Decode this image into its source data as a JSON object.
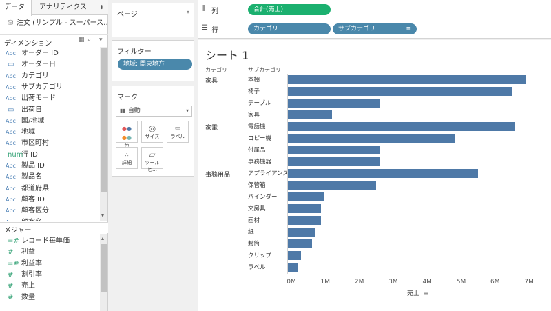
{
  "left_pane": {
    "tab_data": "データ",
    "tab_analytics": "アナリティクス",
    "analytics_caret": "⬍",
    "source": "注文 (サンプル - スーパース…",
    "dimensions_label": "ディメンション",
    "dimensions": [
      {
        "type": "Abc",
        "name": "オーダー ID"
      },
      {
        "type": "cal",
        "name": "オーダー日"
      },
      {
        "type": "Abc",
        "name": "カテゴリ"
      },
      {
        "type": "Abc",
        "name": "サブカテゴリ"
      },
      {
        "type": "Abc",
        "name": "出荷モード"
      },
      {
        "type": "cal",
        "name": "出荷日"
      },
      {
        "type": "Abc",
        "name": "国/地域"
      },
      {
        "type": "Abc",
        "name": "地域"
      },
      {
        "type": "Abc",
        "name": "市区町村"
      },
      {
        "type": "num",
        "name": "行 ID"
      },
      {
        "type": "Abc",
        "name": "製品 ID"
      },
      {
        "type": "Abc",
        "name": "製品名"
      },
      {
        "type": "Abc",
        "name": "都道府県"
      },
      {
        "type": "Abc",
        "name": "顧客 ID"
      },
      {
        "type": "Abc",
        "name": "顧客区分"
      },
      {
        "type": "Abc",
        "name": "顧客名"
      }
    ],
    "measures_label": "メジャー",
    "measures": [
      {
        "type": "=#",
        "name": "レコード毎単価"
      },
      {
        "type": "#",
        "name": "利益"
      },
      {
        "type": "=#",
        "name": "利益率"
      },
      {
        "type": "#",
        "name": "割引率"
      },
      {
        "type": "#",
        "name": "売上"
      },
      {
        "type": "#",
        "name": "数量"
      }
    ]
  },
  "cards": {
    "pages_label": "ページ",
    "filters_label": "フィルター",
    "filter_pill": "地域: 関東地方",
    "marks_label": "マーク",
    "mark_type": "自動",
    "mark_buttons": [
      "色",
      "サイズ",
      "ラベル",
      "詳細",
      "ツールヒ…"
    ]
  },
  "shelves": {
    "columns_label": "列",
    "columns_pill": "合計(売上)",
    "rows_label": "行",
    "rows_pills": [
      "カテゴリ",
      "サブカテゴリ"
    ]
  },
  "view": {
    "sheet_title": "シート 1",
    "col_header_category": "カテゴリ",
    "col_header_subcategory": "サブカテゴリ",
    "axis_title": "売上",
    "bar_color": "#4e79a7"
  },
  "chart_data": {
    "type": "bar",
    "orientation": "horizontal",
    "xlabel": "売上",
    "xlim": [
      0,
      7300000
    ],
    "ticks": [
      "0M",
      "1M",
      "2M",
      "3M",
      "4M",
      "5M",
      "6M",
      "7M"
    ],
    "groups": [
      {
        "category": "家具",
        "items": [
          {
            "name": "本棚",
            "value": 7000000
          },
          {
            "name": "椅子",
            "value": 6600000
          },
          {
            "name": "テーブル",
            "value": 2700000
          },
          {
            "name": "家具",
            "value": 1300000
          }
        ]
      },
      {
        "category": "家電",
        "items": [
          {
            "name": "電話機",
            "value": 6700000
          },
          {
            "name": "コピー機",
            "value": 4900000
          },
          {
            "name": "付属品",
            "value": 2700000
          },
          {
            "name": "事務機器",
            "value": 2700000
          }
        ]
      },
      {
        "category": "事務用品",
        "items": [
          {
            "name": "アプライアンス",
            "value": 5600000
          },
          {
            "name": "保管箱",
            "value": 2600000
          },
          {
            "name": "バインダー",
            "value": 1050000
          },
          {
            "name": "文房具",
            "value": 980000
          },
          {
            "name": "画材",
            "value": 980000
          },
          {
            "name": "紙",
            "value": 800000
          },
          {
            "name": "封筒",
            "value": 700000
          },
          {
            "name": "クリップ",
            "value": 380000
          },
          {
            "name": "ラベル",
            "value": 300000
          }
        ]
      }
    ]
  }
}
